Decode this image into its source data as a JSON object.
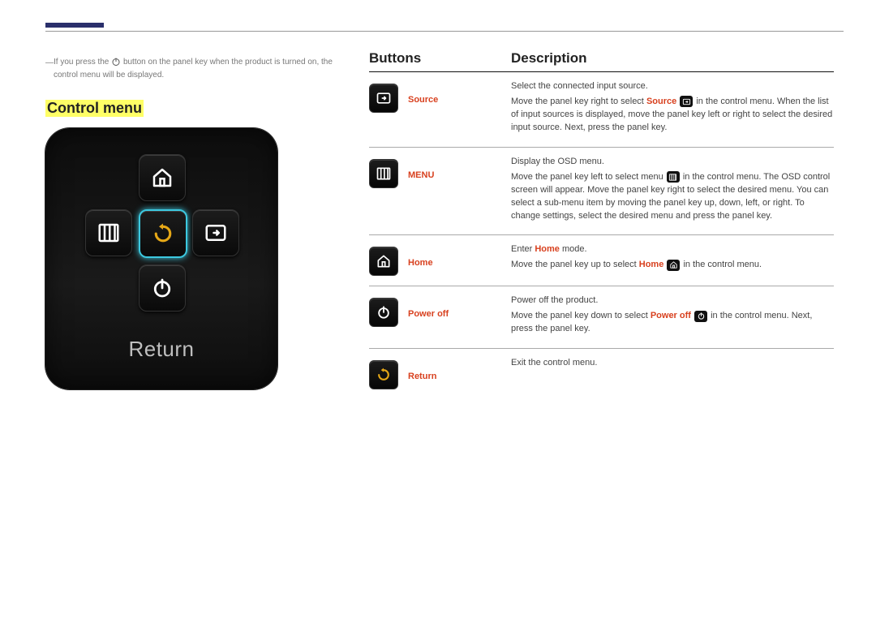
{
  "note": {
    "pre": "If you press the ",
    "post": " button on the panel key when the product is turned on, the control menu will be displayed."
  },
  "heading": "Control menu",
  "panel": {
    "label": "Return"
  },
  "table": {
    "headers": {
      "buttons": "Buttons",
      "description": "Description"
    },
    "rows": [
      {
        "id": "source",
        "name": "Source",
        "line1": "Select the connected input source.",
        "line2_pre": "Move the panel key right to select ",
        "line2_kw": "Source",
        "line2_post": " in the control menu. When the list of input sources is displayed, move the panel key left or right to select the desired input source. Next, press the panel key."
      },
      {
        "id": "menu",
        "name": "MENU",
        "line1": "Display the OSD menu.",
        "line2_pre": "Move the panel key left to select menu ",
        "line2_kw": "",
        "line2_post": " in the control menu. The OSD control screen will appear. Move the panel key right to select the desired menu. You can select a sub-menu item by moving the panel key up, down, left, or right. To change settings, select the desired menu and press the panel key."
      },
      {
        "id": "home",
        "name": "Home",
        "line1_pre": "Enter ",
        "line1_kw": "Home",
        "line1_post": " mode.",
        "line2_pre": "Move the panel key up to select ",
        "line2_kw": "Home",
        "line2_post": " in the control menu."
      },
      {
        "id": "poweroff",
        "name": "Power off",
        "line1": "Power off the product.",
        "line2_pre": "Move the panel key down to select ",
        "line2_kw": "Power off",
        "line2_post": " in the control menu. Next, press the panel key."
      },
      {
        "id": "return",
        "name": "Return",
        "line1": "Exit the control menu."
      }
    ]
  }
}
